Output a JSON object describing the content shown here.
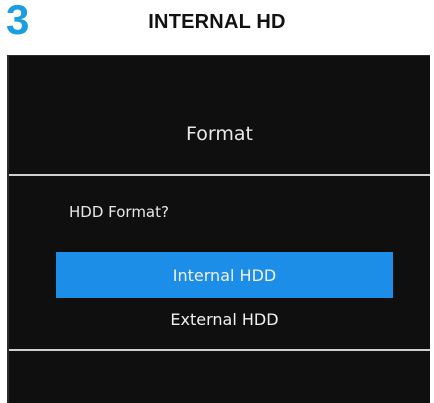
{
  "step": {
    "number": "3",
    "title": "INTERNAL HD"
  },
  "dialog": {
    "title": "Format",
    "prompt": "HDD Format?",
    "options": [
      {
        "label": "Internal HDD",
        "selected": true
      },
      {
        "label": "External HDD",
        "selected": false
      }
    ]
  },
  "colors": {
    "accent": "#1a9ee0",
    "selection": "#1c8ee8",
    "screen_background": "#0f0f0f"
  }
}
